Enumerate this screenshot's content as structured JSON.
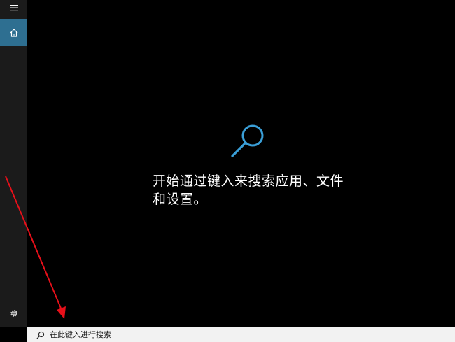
{
  "sidebar": {
    "icons": {
      "menu": "hamburger-menu-icon",
      "home": "home-icon",
      "settings": "gear-icon"
    },
    "active_color": "#2e6f91"
  },
  "main": {
    "illustration_icon": "magnifier-icon",
    "accent_color": "#3a9fd8",
    "hint_line1": "开始通过键入来搜索应用、文件",
    "hint_line2": "和设置。"
  },
  "searchbar": {
    "icon": "search-icon",
    "placeholder": "在此键入进行搜索"
  },
  "annotation": {
    "arrow_color": "#e8101a"
  }
}
